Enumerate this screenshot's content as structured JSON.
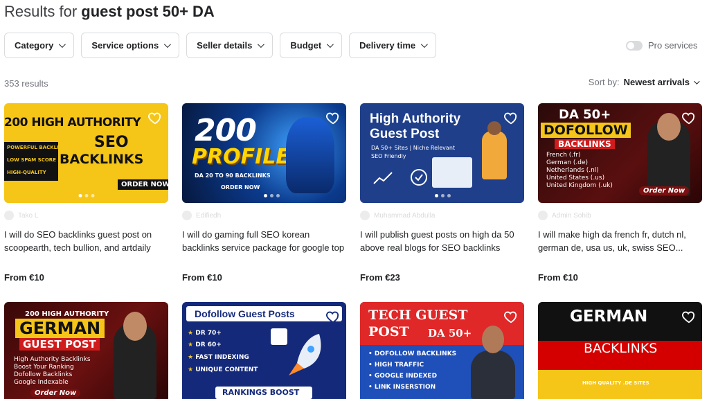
{
  "header": {
    "prefix": "Results for ",
    "query": "guest post 50+ DA"
  },
  "filters": [
    "Category",
    "Service options",
    "Seller details",
    "Budget",
    "Delivery time"
  ],
  "pro_toggle": {
    "label": "Pro services",
    "on": false
  },
  "results_count": "353 results",
  "sort": {
    "label": "Sort by:",
    "value": "Newest arrivals"
  },
  "colors": {
    "accent": "#1dbf73",
    "text": "#222325",
    "muted": "#74767e"
  },
  "gigs": [
    {
      "title": "I will do SEO backlinks guest post on scoopearth, tech bullion, and artdaily",
      "price": "From €10",
      "seller": "Tako L",
      "thumb": {
        "lines": [
          "200 HIGH AUTHORITY",
          "SEO",
          "BACKLINKS",
          "POWERFUL BACKLINKS",
          "LOW SPAM SCORE",
          "HIGH-QUALITY",
          "ORDER NOW"
        ]
      }
    },
    {
      "title": "I will do gaming full SEO korean backlinks service package for google top ranking",
      "price": "From €10",
      "seller": "Edifiedh",
      "thumb": {
        "lines": [
          "200",
          "PROFILE",
          "DA 20 TO 90 BACKLINKS",
          "ORDER NOW"
        ]
      }
    },
    {
      "title": "I will publish guest posts on high da 50 above real blogs for SEO backlinks",
      "price": "From €23",
      "seller": "Muhammad Abdulla",
      "thumb": {
        "lines": [
          "High Authority",
          "Guest Post",
          "DA 50+ Sites | Niche Relevant",
          "SEO Friendly"
        ]
      }
    },
    {
      "title": "I will make high da french fr, dutch nl, german de, usa us, uk, swiss SEO...",
      "price": "From €10",
      "seller": "Admin Sohib",
      "thumb": {
        "lines": [
          "DA 50+",
          "DOFOLLOW",
          "BACKLINKS",
          "French (.fr)",
          "German (.de)",
          "Netherlands (.nl)",
          "United States (.us)",
          "United Kingdom (.uk)",
          "Order Now"
        ]
      }
    },
    {
      "thumb": {
        "lines": [
          "200 HIGH AUTHORITY",
          "GERMAN",
          "GUEST POST",
          "High Authority Backlinks",
          "Boost Your Ranking",
          "Dofollow Backlinks",
          "Google Indexable",
          "Order Now"
        ]
      }
    },
    {
      "thumb": {
        "lines": [
          "Dofollow Guest Posts",
          "DR 70+",
          "DR 60+",
          "FAST INDEXING",
          "UNIQUE CONTENT",
          "RANKINGS BOOST"
        ]
      }
    },
    {
      "thumb": {
        "lines": [
          "TECH GUEST",
          "POST",
          "DA 50+",
          "DOFOLLOW BACKLINKS",
          "HIGH TRAFFIC",
          "GOOGLE INDEXED",
          "LINK INSERSTION"
        ]
      }
    },
    {
      "thumb": {
        "lines": [
          "GERMAN",
          "BACKLINKS",
          "HIGH QUALITY .DE SITES"
        ]
      }
    }
  ]
}
